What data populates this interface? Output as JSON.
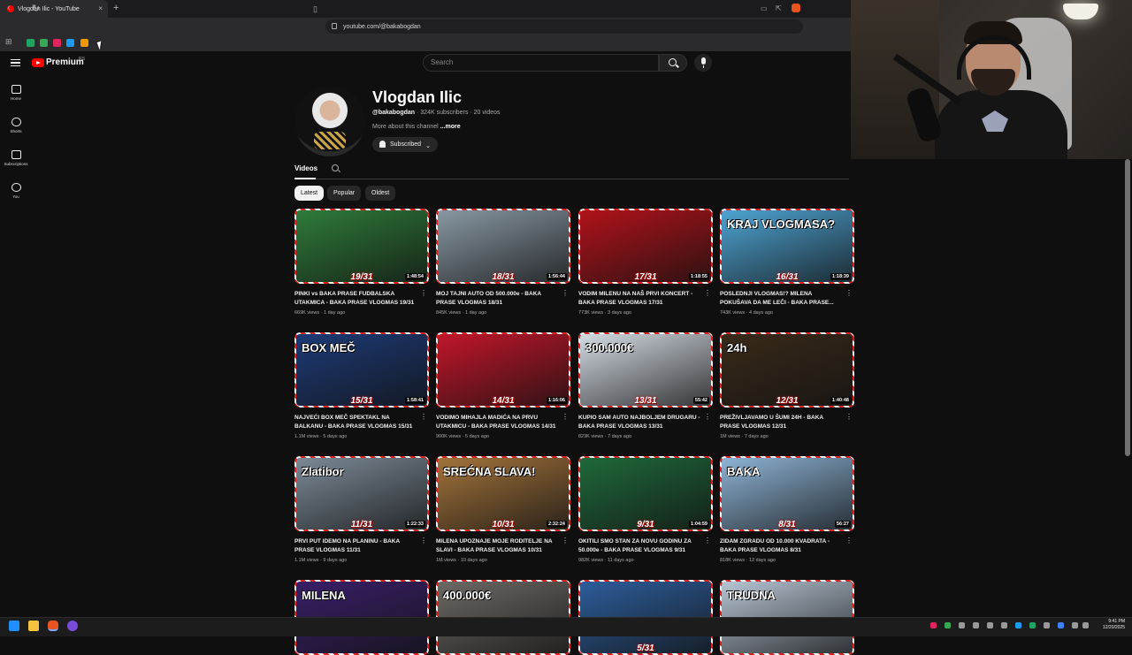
{
  "browser": {
    "tab_title": "Vlogdan Ilic - YouTube",
    "new_tab": "+",
    "tab_close": "×",
    "url": "youtube.com/@bakabogdan"
  },
  "youtube": {
    "logo_text": "Premium",
    "logo_sup": "RS",
    "search_placeholder": "Search",
    "sidebar": [
      {
        "label": "Home",
        "icon": "home-icon"
      },
      {
        "label": "Shorts",
        "icon": "shorts-icon"
      },
      {
        "label": "Subscriptions",
        "icon": "subscriptions-icon"
      },
      {
        "label": "You",
        "icon": "you-icon"
      }
    ]
  },
  "channel": {
    "name": "Vlogdan Ilic",
    "handle": "@bakabogdan",
    "stats": " · 324K subscribers · 20 videos",
    "about": "More about this channel",
    "more": " ...more",
    "subscribe_label": "Subscribed",
    "tab_videos": "Videos",
    "chips": [
      "Latest",
      "Popular",
      "Oldest"
    ]
  },
  "videos": [
    {
      "title": "PINKI vs BAKA PRASE FUDBALSKA UTAKMICA - BAKA PRASE VLOGMAS 19/31",
      "views": "669K views",
      "age": "1 day ago",
      "duration": "1:48:54",
      "ep": "19/31",
      "bg": "#2f7d3a"
    },
    {
      "title": "MOJ TAJNI AUTO OD 500.000e - BAKA PRASE VLOGMAS 18/31",
      "views": "845K views",
      "age": "1 day ago",
      "duration": "1:56:44",
      "ep": "18/31",
      "bg": "#8a9aa5"
    },
    {
      "title": "VODIM MILENU NA NAŠ PRVI KONCERT - BAKA PRASE VLOGMAS 17/31",
      "views": "773K views",
      "age": "3 days ago",
      "duration": "1:18:55",
      "ep": "17/31",
      "bg": "#b3121a"
    },
    {
      "title": "POSLEDNJI VLOGMAS!? MILENA POKUŠAVA DA ME LEČI - BAKA PRASE...",
      "views": "743K views",
      "age": "4 days ago",
      "duration": "1:18:39",
      "ep": "16/31",
      "bg": "#4fa6d6",
      "overlay": "KRAJ VLOGMASA?"
    },
    {
      "title": "NAJVEĆI BOX MEČ SPEKTAKL NA BALKANU - BAKA PRASE VLOGMAS 15/31",
      "views": "1.1M views",
      "age": "5 days ago",
      "duration": "1:58:41",
      "ep": "15/31",
      "bg": "#1d3b78",
      "overlay": "BOX MEČ"
    },
    {
      "title": "VODIMO MIHAJLA MADIĆA NA PRVU UTAKMICU - BAKA PRASE VLOGMAS 14/31",
      "views": "900K views",
      "age": "5 days ago",
      "duration": "1:16:06",
      "ep": "14/31",
      "bg": "#c4162a"
    },
    {
      "title": "KUPIO SAM AUTO NAJBOLJEM DRUGARU - BAKA PRASE VLOGMAS 13/31",
      "views": "823K views",
      "age": "7 days ago",
      "duration": "55:42",
      "ep": "13/31",
      "bg": "#d7dee6",
      "overlay": "300.000€"
    },
    {
      "title": "PREŽIVLJAVAMO U ŠUMI 24H - BAKA PRASE VLOGMAS 12/31",
      "views": "1M views",
      "age": "7 days ago",
      "duration": "1:40:48",
      "ep": "12/31",
      "bg": "#3a2a1a",
      "overlay": "24h"
    },
    {
      "title": "PRVI PUT IDEMO NA PLANINU - BAKA PRASE VLOGMAS 11/31",
      "views": "1.1M views",
      "age": "9 days ago",
      "duration": "1:22:33",
      "ep": "11/31",
      "bg": "#7d8c99",
      "overlay": "Zlatibor"
    },
    {
      "title": "MILENA UPOZNAJE MOJE RODITELJE NA SLAVI - BAKA PRASE VLOGMAS 10/31",
      "views": "1M views",
      "age": "10 days ago",
      "duration": "2:32:24",
      "ep": "10/31",
      "bg": "#a5753c",
      "overlay": "SREĆNA SLAVA!"
    },
    {
      "title": "OKITILI SMO STAN ZA NOVU GODINU ZA 50.000e - BAKA PRASE VLOGMAS 9/31",
      "views": "982K views",
      "age": "11 days ago",
      "duration": "1:04:59",
      "ep": "9/31",
      "bg": "#1f6a3c"
    },
    {
      "title": "ZIDAM ZGRADU OD 10.000 KVADRATA - BAKA PRASE VLOGMAS 8/31",
      "views": "818K views",
      "age": "12 days ago",
      "duration": "56:27",
      "ep": "8/31",
      "bg": "#8fb6d8",
      "overlay": "BAKA"
    },
    {
      "title": "",
      "views": "",
      "age": "",
      "duration": "",
      "ep": "",
      "bg": "#3a1f6a",
      "overlay": "MILENA"
    },
    {
      "title": "",
      "views": "",
      "age": "",
      "duration": "",
      "ep": "",
      "bg": "#6e6a66",
      "overlay": "400.000€"
    },
    {
      "title": "",
      "views": "",
      "age": "",
      "duration": "",
      "ep": "5/31",
      "bg": "#2d5e9c"
    },
    {
      "title": "",
      "views": "",
      "age": "",
      "duration": "",
      "ep": "",
      "bg": "#b9c7d6",
      "overlay": "TRUDNA"
    }
  ],
  "clock": {
    "time": "9:41 PM",
    "date": "12/20/2025"
  }
}
